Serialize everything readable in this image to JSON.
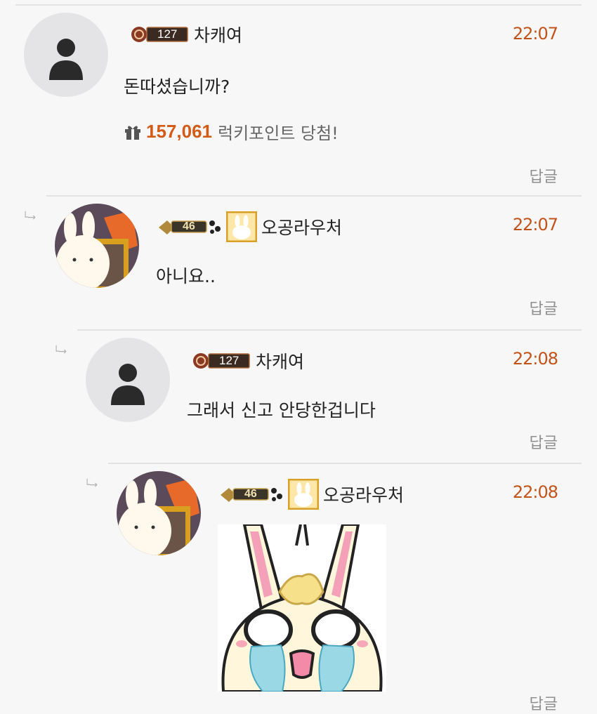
{
  "colors": {
    "time": "#c2541b",
    "points": "#d25b18",
    "reply": "#8f8f8f",
    "divider": "#e3e3e3"
  },
  "reply_label": "답글",
  "comments": [
    {
      "level": "127",
      "name": "차캐여",
      "time": "22:07",
      "text": "돈따셨습니까?",
      "lucky_points": "157,061",
      "lucky_text": "럭키포인트 당첨!",
      "avatar": "default-user-icon"
    },
    {
      "level": "46",
      "name": "오공라우처",
      "time": "22:07",
      "text": "아니요..",
      "avatar": "bunny-avatar"
    },
    {
      "level": "127",
      "name": "차캐여",
      "time": "22:08",
      "text": "그래서 신고 안당한겁니다",
      "avatar": "default-user-icon"
    },
    {
      "level": "46",
      "name": "오공라우처",
      "time": "22:08",
      "text": "",
      "avatar": "bunny-avatar",
      "sticker": "crying-bunny-sticker"
    }
  ]
}
